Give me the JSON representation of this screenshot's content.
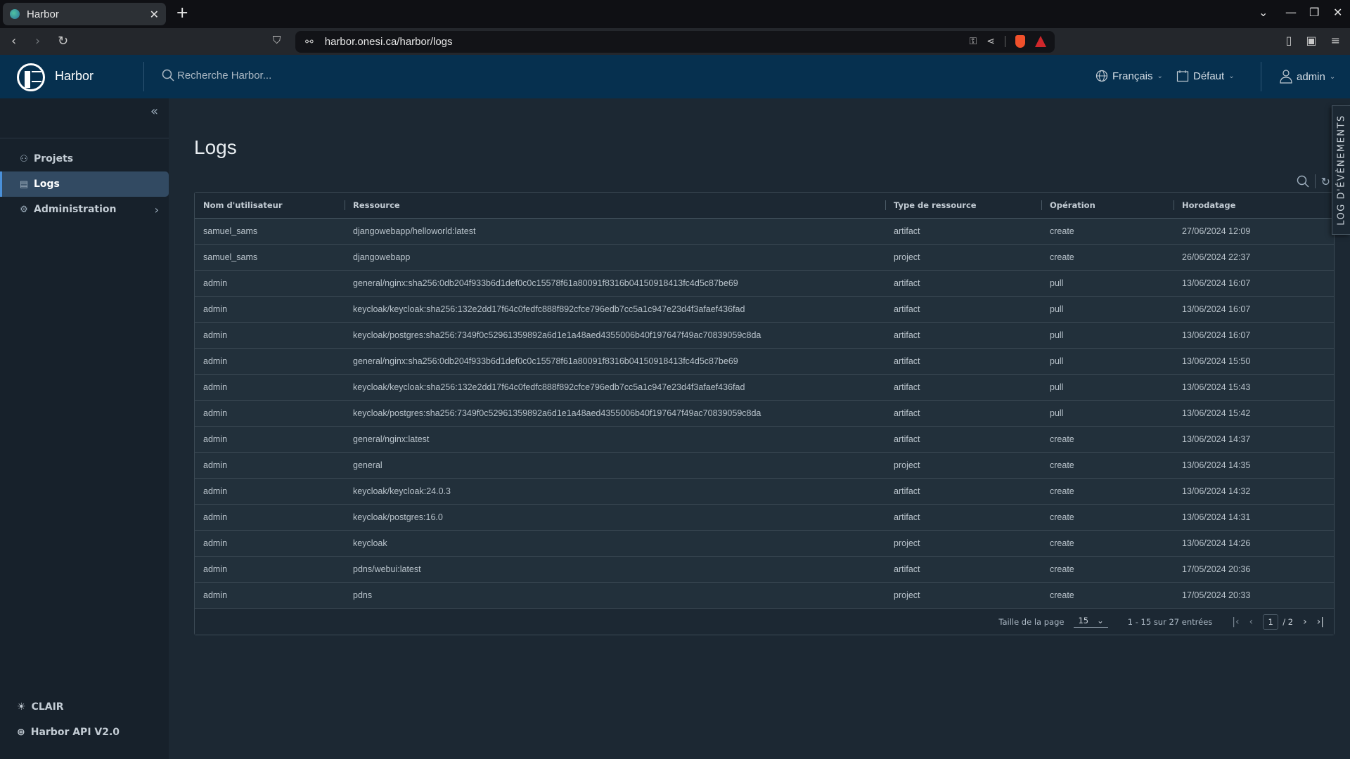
{
  "browser": {
    "tab_title": "Harbor",
    "tab_close": "✕",
    "new_tab": "+",
    "url": "harbor.onesi.ca/harbor/logs",
    "window_controls": {
      "dropdown": "⌄",
      "minimize": "—",
      "restore": "❐",
      "close": "✕"
    },
    "nav": {
      "back": "‹",
      "forward": "›",
      "reload": "↻",
      "bookmark": "⛉"
    },
    "url_icons": {
      "site_settings": "⚯",
      "key": "⚿",
      "share": "⋖"
    },
    "right_tools": {
      "sidebar": "▯",
      "wallet": "▣",
      "menu": "≡"
    }
  },
  "header": {
    "brand": "Harbor",
    "search_placeholder": "Recherche Harbor...",
    "language": "Français",
    "theme": "Défaut",
    "user": "admin",
    "chevron": "⌄"
  },
  "sidebar": {
    "collapse_icon": "«",
    "items": [
      {
        "label": "Projets",
        "icon": "⚇",
        "active": false
      },
      {
        "label": "Logs",
        "icon": "▤",
        "active": true
      },
      {
        "label": "Administration",
        "icon": "⚙",
        "active": false,
        "arrow": "›"
      }
    ],
    "footer": [
      {
        "label": "CLAIR",
        "icon": "☀"
      },
      {
        "label": "Harbor API V2.0",
        "icon": "⊛"
      }
    ]
  },
  "main": {
    "title": "Logs",
    "actions": {
      "search_icon": "⌕",
      "refresh_icon": "↻"
    },
    "columns": [
      "Nom d'utilisateur",
      "Ressource",
      "Type de ressource",
      "Opération",
      "Horodatage"
    ],
    "rows": [
      [
        "samuel_sams",
        "djangowebapp/helloworld:latest",
        "artifact",
        "create",
        "27/06/2024 12:09"
      ],
      [
        "samuel_sams",
        "djangowebapp",
        "project",
        "create",
        "26/06/2024 22:37"
      ],
      [
        "admin",
        "general/nginx:sha256:0db204f933b6d1def0c0c15578f61a80091f8316b04150918413fc4d5c87be69",
        "artifact",
        "pull",
        "13/06/2024 16:07"
      ],
      [
        "admin",
        "keycloak/keycloak:sha256:132e2dd17f64c0fedfc888f892cfce796edb7cc5a1c947e23d4f3afaef436fad",
        "artifact",
        "pull",
        "13/06/2024 16:07"
      ],
      [
        "admin",
        "keycloak/postgres:sha256:7349f0c52961359892a6d1e1a48aed4355006b40f197647f49ac70839059c8da",
        "artifact",
        "pull",
        "13/06/2024 16:07"
      ],
      [
        "admin",
        "general/nginx:sha256:0db204f933b6d1def0c0c15578f61a80091f8316b04150918413fc4d5c87be69",
        "artifact",
        "pull",
        "13/06/2024 15:50"
      ],
      [
        "admin",
        "keycloak/keycloak:sha256:132e2dd17f64c0fedfc888f892cfce796edb7cc5a1c947e23d4f3afaef436fad",
        "artifact",
        "pull",
        "13/06/2024 15:43"
      ],
      [
        "admin",
        "keycloak/postgres:sha256:7349f0c52961359892a6d1e1a48aed4355006b40f197647f49ac70839059c8da",
        "artifact",
        "pull",
        "13/06/2024 15:42"
      ],
      [
        "admin",
        "general/nginx:latest",
        "artifact",
        "create",
        "13/06/2024 14:37"
      ],
      [
        "admin",
        "general",
        "project",
        "create",
        "13/06/2024 14:35"
      ],
      [
        "admin",
        "keycloak/keycloak:24.0.3",
        "artifact",
        "create",
        "13/06/2024 14:32"
      ],
      [
        "admin",
        "keycloak/postgres:16.0",
        "artifact",
        "create",
        "13/06/2024 14:31"
      ],
      [
        "admin",
        "keycloak",
        "project",
        "create",
        "13/06/2024 14:26"
      ],
      [
        "admin",
        "pdns/webui:latest",
        "artifact",
        "create",
        "17/05/2024 20:36"
      ],
      [
        "admin",
        "pdns",
        "project",
        "create",
        "17/05/2024 20:33"
      ]
    ],
    "footer": {
      "page_size_label": "Taille de la page",
      "page_size": "15",
      "range_text": "1 - 15 sur 27 entrées",
      "current_page": "1",
      "total_pages_text": "/ 2",
      "first": "|‹",
      "prev": "‹",
      "next": "›",
      "last": "›|"
    }
  },
  "events_panel": {
    "label": "LOG D'ÉVÈNEMENTS"
  }
}
